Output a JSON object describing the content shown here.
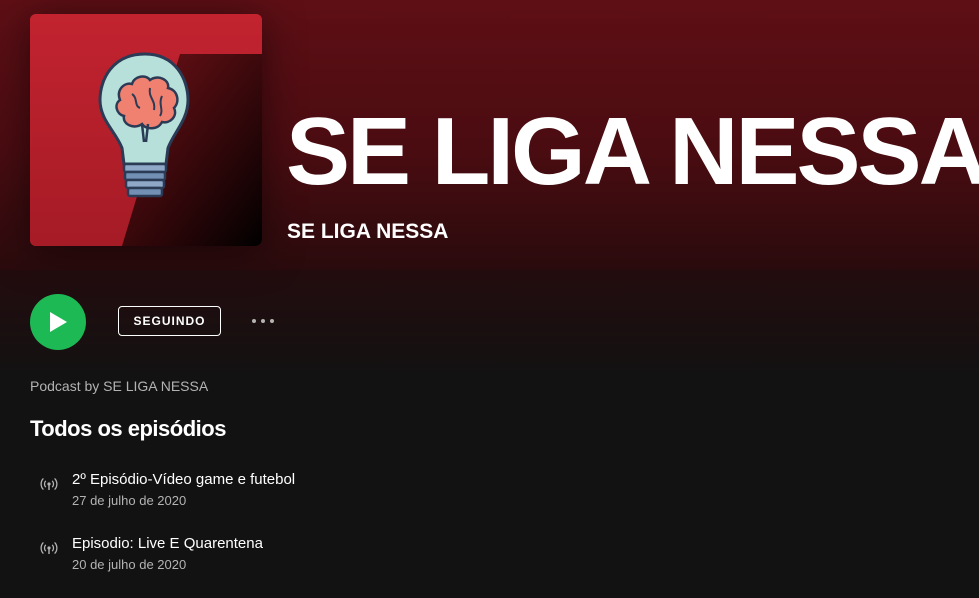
{
  "podcast": {
    "title": "SE LIGA NESSA",
    "publisher": "SE LIGA NESSA",
    "cover_icon": "lightbulb-brain-icon"
  },
  "actions": {
    "play_icon": "play-icon",
    "follow_label": "SEGUINDO",
    "more_icon": "more-options-icon"
  },
  "about": {
    "podcast_by": "Podcast by SE LIGA NESSA"
  },
  "episodes_section": {
    "title": "Todos os episódios",
    "items": [
      {
        "title": "2º Episódio-Vídeo game e futebol",
        "date": "27 de julho de 2020",
        "icon": "podcast-broadcast-icon"
      },
      {
        "title": "Episodio: Live E Quarentena",
        "date": "20 de julho de 2020",
        "icon": "podcast-broadcast-icon"
      }
    ]
  },
  "colors": {
    "header_bg": "#5e0f15",
    "page_bg": "#121212",
    "play_green": "#1db954",
    "cover_red": "#b5202c",
    "secondary_text": "#b3b3b3"
  }
}
